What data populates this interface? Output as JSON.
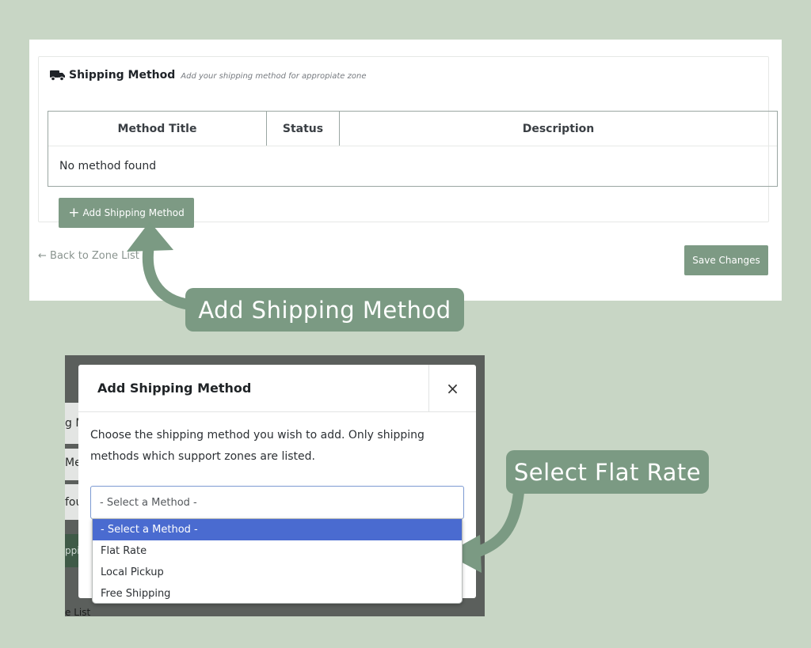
{
  "top_panel": {
    "header": {
      "title": "Shipping Method",
      "subtitle": "Add your shipping method for appropiate zone",
      "icon": "truck-icon"
    },
    "table": {
      "columns": [
        "Method Title",
        "Status",
        "Description"
      ],
      "empty_text": "No method found"
    },
    "add_button": {
      "label": "Add Shipping Method",
      "icon": "plus"
    },
    "back_link": "← Back to Zone List",
    "save_button": "Save Changes"
  },
  "callouts": {
    "add": "Add Shipping Method",
    "flat": "Select Flat Rate"
  },
  "modal": {
    "title": "Add Shipping Method",
    "close": "×",
    "description": "Choose the shipping method you wish to add. Only shipping methods which support zones are listed.",
    "select_value": "- Select a Method -",
    "options": [
      "- Select a Method -",
      "Flat Rate",
      "Local Pickup",
      "Free Shipping"
    ],
    "selected_option": "- Select a Method -"
  },
  "background_fragments": [
    "g M",
    "Me",
    "fou",
    "ppin",
    "e List"
  ],
  "colors": {
    "page_background": "#c8d6c5",
    "accent_green": "#7d9a84",
    "callout_green": "#7b9a83",
    "selected_blue": "#4a6bd0"
  }
}
